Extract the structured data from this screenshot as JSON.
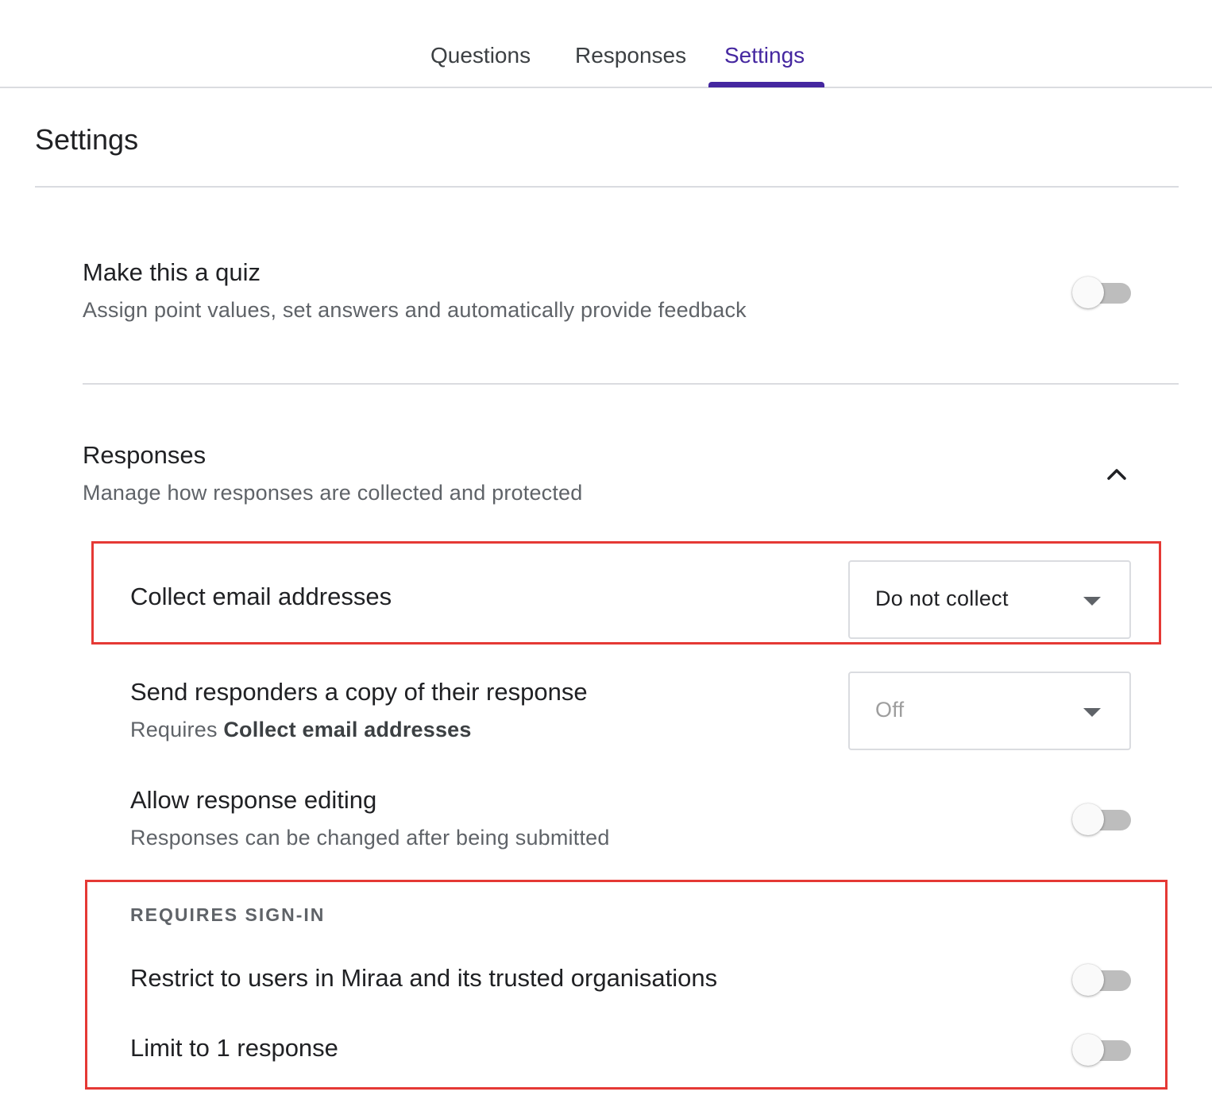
{
  "tabs": {
    "questions": "Questions",
    "responses": "Responses",
    "settings": "Settings",
    "active": "settings"
  },
  "page_title": "Settings",
  "quiz": {
    "title": "Make this a quiz",
    "subtitle": "Assign point values, set answers and automatically provide feedback",
    "enabled": false
  },
  "responses_section": {
    "title": "Responses",
    "subtitle": "Manage how responses are collected and protected",
    "expanded": true,
    "expand_icon": "chevron-up-icon",
    "collect_email": {
      "label": "Collect email addresses",
      "value": "Do not collect"
    },
    "send_copy": {
      "label": "Send responders a copy of their response",
      "requires_prefix": "Requires",
      "requires_bold": "Collect email addresses",
      "value": "Off",
      "disabled": true
    },
    "allow_editing": {
      "label": "Allow response editing",
      "subtitle": "Responses can be changed after being submitted",
      "enabled": false
    },
    "requires_signin": {
      "heading": "REQUIRES SIGN-IN",
      "restrict_users": {
        "label": "Restrict to users in Miraa and its trusted organisations",
        "enabled": false
      },
      "limit_response": {
        "label": "Limit to 1 response",
        "enabled": false
      }
    }
  },
  "colors": {
    "accent": "#4527a0",
    "highlight": "#e53935",
    "toggle_off_track": "#bdbdbd",
    "text_secondary": "#5f6368"
  }
}
